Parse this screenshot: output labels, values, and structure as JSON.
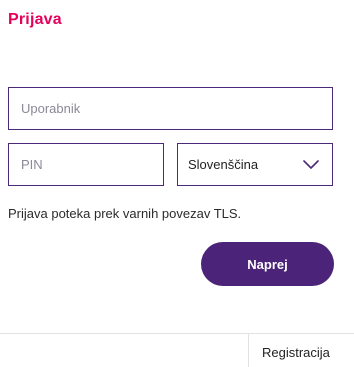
{
  "login": {
    "title": "Prijava",
    "username_placeholder": "Uporabnik",
    "pin_placeholder": "PIN",
    "language": {
      "selected": "Slovenščina",
      "icon": "chevron-down-icon"
    },
    "tls_note": "Prijava poteka prek varnih povezav TLS.",
    "next_label": "Naprej"
  },
  "footer": {
    "register_label": "Registracija"
  },
  "colors": {
    "title": "#e5005a",
    "accent": "#4b2378",
    "border": "#4b2a7a"
  }
}
